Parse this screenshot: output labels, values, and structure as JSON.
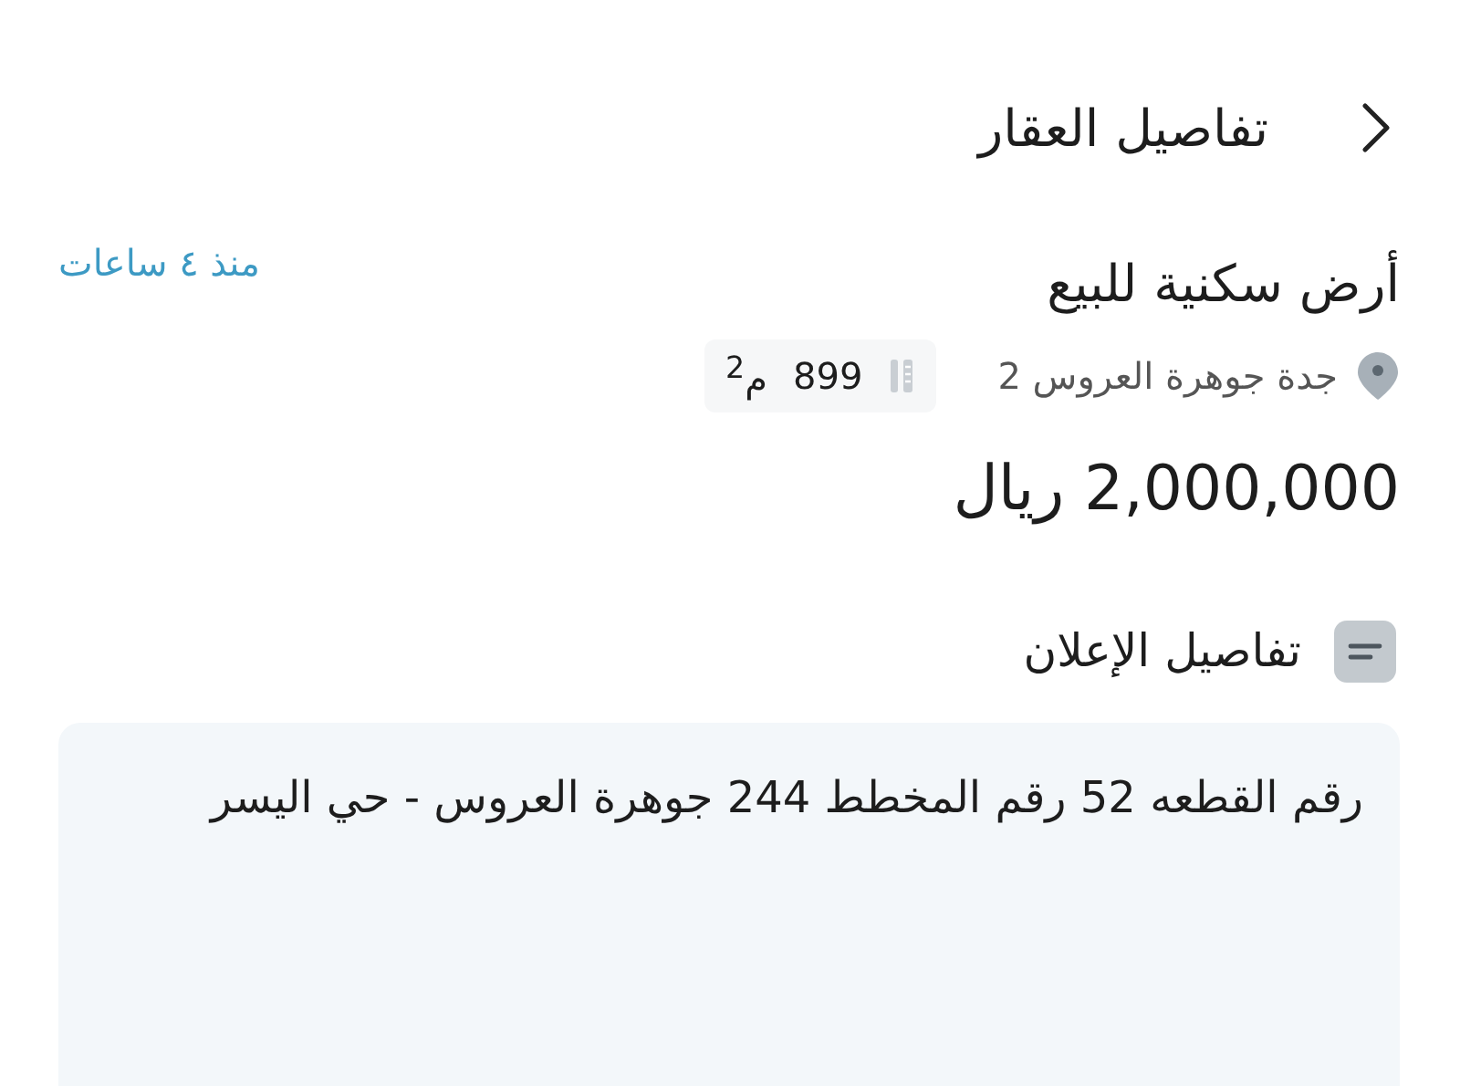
{
  "header": {
    "title": "تفاصيل العقار"
  },
  "listing": {
    "title": "أرض سكنية للبيع",
    "posted": "منذ ٤ ساعات",
    "location": "جدة جوهرة العروس 2",
    "area": {
      "value": "899",
      "unit": "م$^{2}$"
    },
    "price": "2,000,000 ريال"
  },
  "details_section": {
    "title": "تفاصيل الإعلان",
    "description": "رقم القطعه 52 رقم المخطط 244 جوهرة العروس - حي اليسر"
  }
}
